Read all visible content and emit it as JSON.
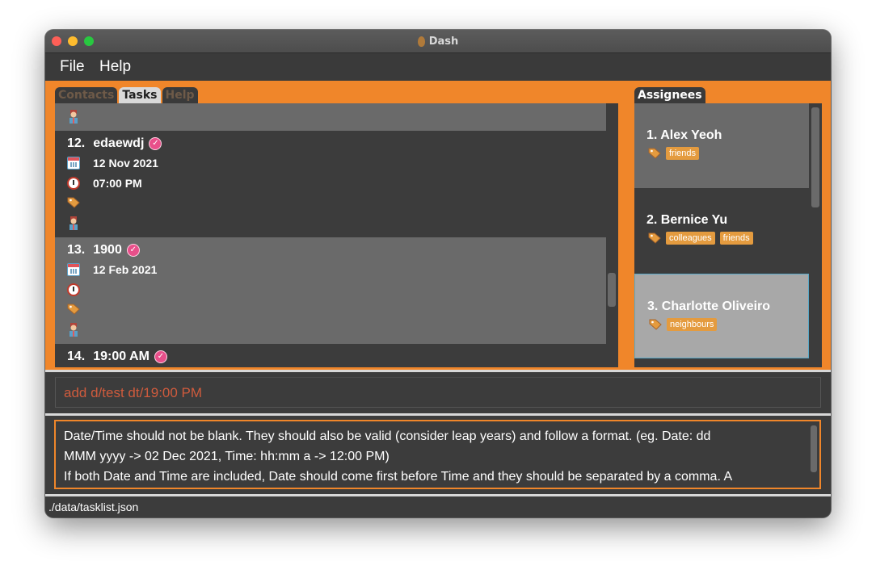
{
  "window": {
    "title": "Dash"
  },
  "menu": {
    "file": "File",
    "help": "Help"
  },
  "tabs": {
    "contacts": "Contacts",
    "tasks": "Tasks",
    "help": "Help"
  },
  "tasks": [
    {
      "index": "12.",
      "name": "edaewdj",
      "date": "12 Nov 2021",
      "time": "07:00 PM"
    },
    {
      "index": "13.",
      "name": "1900",
      "date": "12 Feb 2021",
      "time": ""
    },
    {
      "index": "14.",
      "name": "19:00 AM",
      "date": "",
      "time": ""
    }
  ],
  "assignees": {
    "tab_label": "Assignees",
    "items": [
      {
        "name": "1.  Alex Yeoh",
        "tags": [
          "friends"
        ]
      },
      {
        "name": "2.  Bernice Yu",
        "tags": [
          "colleagues",
          "friends"
        ]
      },
      {
        "name": "3.  Charlotte Oliveiro",
        "tags": [
          "neighbours"
        ]
      }
    ]
  },
  "command": {
    "value": "add d/test dt/19:00 PM"
  },
  "result": {
    "line1": "Date/Time should not be blank. They should also be valid (consider leap years) and follow a format. (eg. Date: dd",
    "line2": "MMM yyyy -> 02 Dec 2021, Time: hh:mm a -> 12:00 PM)",
    "line3": "If both Date and Time are included, Date should come first before Time and they should be separated by a comma. A"
  },
  "status": {
    "path": "./data/tasklist.json"
  },
  "icons": [
    "check-icon",
    "calendar-icon",
    "clock-icon",
    "tag-icon",
    "person-icon"
  ],
  "colors": {
    "accent": "#f0862a",
    "pill": "#e49b3f",
    "error_text": "#cf5b3d",
    "check": "#e84f8a"
  }
}
